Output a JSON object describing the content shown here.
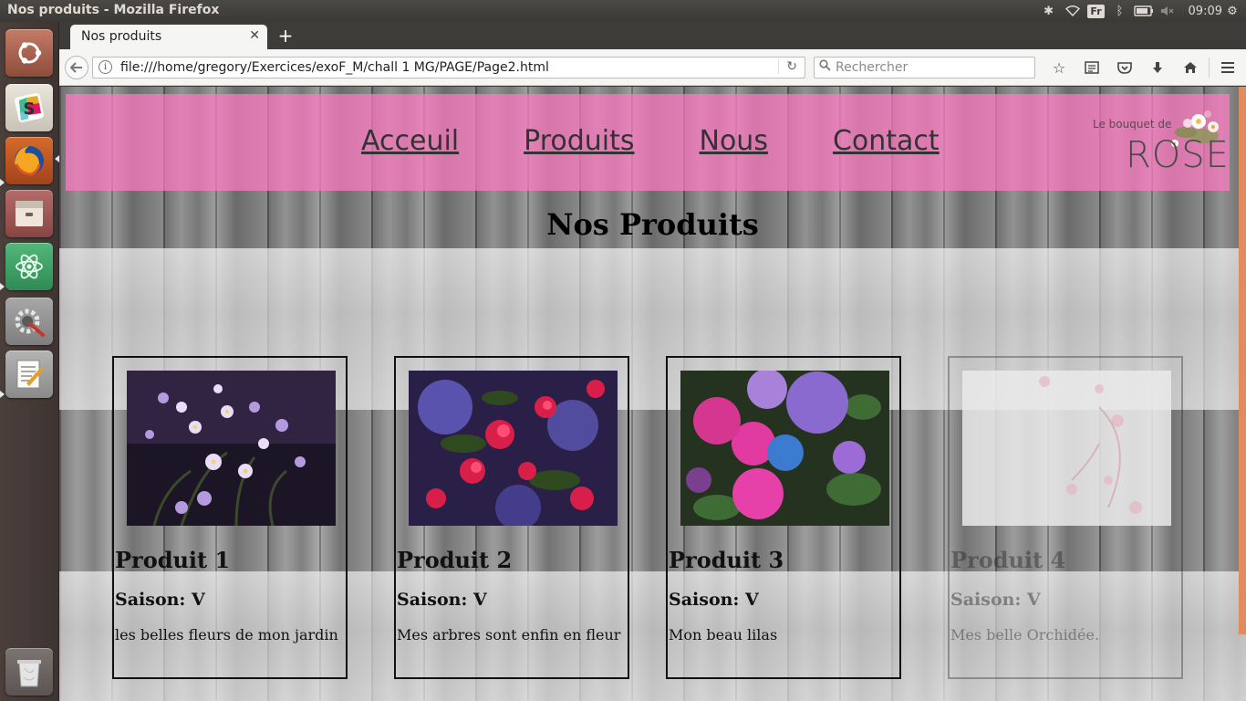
{
  "system": {
    "window_title": "Nos produits - Mozilla Firefox",
    "keyboard_layout": "Fr",
    "clock": "09:09"
  },
  "browser": {
    "tab_title": "Nos produits",
    "url": "file:///home/gregory/Exercices/exoF_M/chall 1 MG/PAGE/Page2.html",
    "search_placeholder": "Rechercher"
  },
  "site": {
    "nav": [
      "Acceuil",
      "Produits",
      "Nous",
      "Contact"
    ],
    "logo_small": "Le bouquet de",
    "logo_big": "ROSE",
    "page_title": "Nos Produits",
    "products": [
      {
        "name": "Produit 1",
        "season": "Saison: V",
        "description": "les belles fleurs de mon jardin",
        "image": "purple-daisies-photo"
      },
      {
        "name": "Produit 2",
        "season": "Saison: V",
        "description": "Mes arbres sont enfin en fleur",
        "image": "red-blossom-tree-photo"
      },
      {
        "name": "Produit 3",
        "season": "Saison: V",
        "description": "Mon beau lilas",
        "image": "hydrangea-photo"
      },
      {
        "name": "Produit 4",
        "season": "Saison: V",
        "description": "Mes belle Orchidée.",
        "image": "faded-orchid-photo"
      }
    ]
  },
  "colors": {
    "header_pink": "#ff7ac4",
    "ubuntu_panel": "#3c3b37",
    "scroll_accent": "#e28b5c"
  }
}
